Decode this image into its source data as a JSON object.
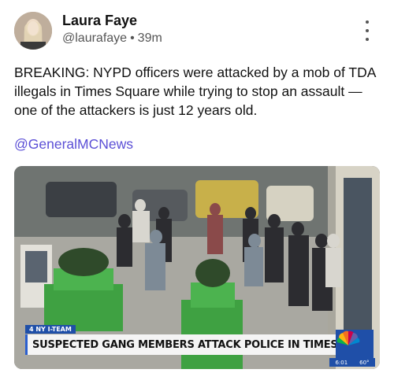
{
  "post": {
    "author_name": "Laura Faye",
    "handle": "@laurafaye",
    "separator": "•",
    "time_ago": "39m",
    "text": "BREAKING: NYPD officers were attacked by a mob of TDA illegals in Times Square while trying to stop an assault — one of the attackers is just 12 years old.",
    "mention": "@GeneralMCNews",
    "more_icon": "vertical-ellipsis-icon"
  },
  "video": {
    "station_tag": "4 NY I-TEAM",
    "chyron": "SUSPECTED GANG MEMBERS ATTACK POLICE IN TIMES SQUARE",
    "logo": "nbc-peacock-icon",
    "clock_time": "6:01",
    "temperature": "60°"
  },
  "colors": {
    "link": "#5b4fd6",
    "chyron_accent": "#1f4fa8"
  }
}
